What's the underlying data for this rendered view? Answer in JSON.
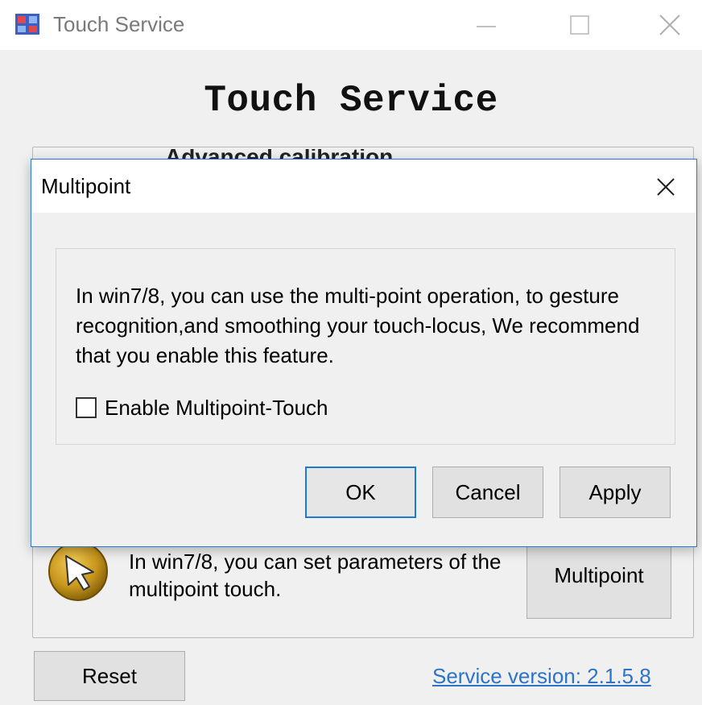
{
  "main_window": {
    "title": "Touch Service",
    "heading": "Touch Service",
    "occluded_text": "Advanced calibration",
    "multipoint_description": "In win7/8, you can set parameters of the multipoint touch.",
    "multipoint_button": "Multipoint",
    "reset_button": "Reset",
    "version_link": "Service version: 2.1.5.8"
  },
  "dialog": {
    "title": "Multipoint",
    "message": "In win7/8, you can use the multi-point operation, to gesture recognition,and smoothing your touch-locus, We recommend that you enable this feature.",
    "checkbox_label": "Enable Multipoint-Touch",
    "checkbox_checked": false,
    "ok_button": "OK",
    "cancel_button": "Cancel",
    "apply_button": "Apply"
  },
  "icons": {
    "app": "touch-service-app-icon",
    "minimize": "minimize-icon",
    "maximize": "maximize-icon",
    "close": "close-icon",
    "multipoint": "cursor-arrow-icon"
  },
  "colors": {
    "accent": "#2b7ad0",
    "link": "#2d73c8",
    "window_bg": "#f0f0f0"
  }
}
